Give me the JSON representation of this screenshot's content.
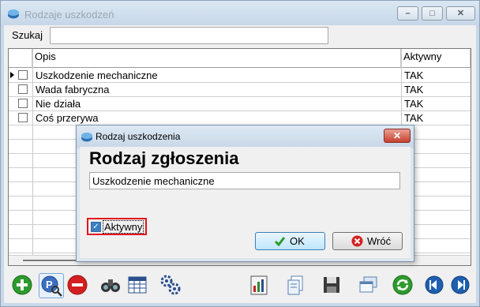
{
  "window": {
    "title": "Rodzaje uszkodzeń",
    "min_glyph": "–",
    "max_glyph": "□",
    "close_glyph": "✕"
  },
  "search": {
    "label": "Szukaj",
    "value": ""
  },
  "grid": {
    "columns": {
      "opis": "Opis",
      "aktywny": "Aktywny"
    },
    "rows": [
      {
        "opis": "Uszkodzenie mechaniczne",
        "aktywny": "TAK"
      },
      {
        "opis": "Wada fabryczna",
        "aktywny": "TAK"
      },
      {
        "opis": "Nie działa",
        "aktywny": "TAK"
      },
      {
        "opis": "Coś przerywa",
        "aktywny": "TAK"
      }
    ]
  },
  "dialog": {
    "title": "Rodzaj uszkodzenia",
    "close_glyph": "✕",
    "heading": "Rodzaj zgłoszenia",
    "name_value": "Uszkodzenie mechaniczne",
    "active_label": "Aktywny",
    "active_checked": true,
    "ok_label": "OK",
    "back_label": "Wróć"
  },
  "toolbar": {
    "icons": [
      "add-icon",
      "edit-icon",
      "delete-icon",
      "binoculars-icon",
      "filter-grid-icon",
      "gears-icon",
      "report-icon",
      "copy-icon",
      "save-icon",
      "windows-icon",
      "refresh-icon",
      "previous-icon",
      "next-icon"
    ]
  },
  "colors": {
    "accent": "#3c7fb1",
    "highlight": "#e2141c",
    "add": "#2e9a2e",
    "delete": "#d42020",
    "nav": "#1f5fb0"
  }
}
